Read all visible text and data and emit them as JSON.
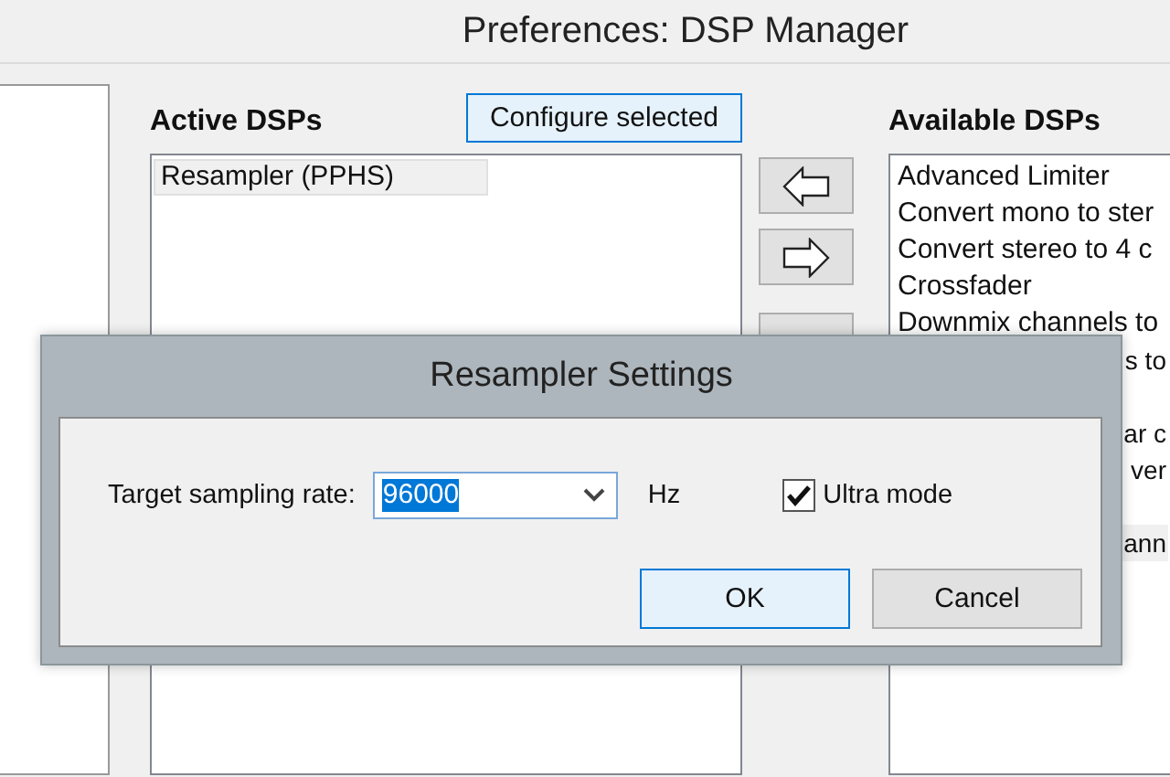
{
  "window": {
    "title": "Preferences: DSP Manager"
  },
  "active_dsps": {
    "label": "Active DSPs",
    "configure_button": "Configure selected",
    "items": [
      {
        "text": "Resampler (PPHS)",
        "selected": true
      }
    ]
  },
  "move_buttons": [
    {
      "kind": "left"
    },
    {
      "kind": "right"
    },
    {
      "kind": "blank"
    }
  ],
  "available_dsps": {
    "label": "Available DSPs",
    "items": [
      {
        "text": "Advanced Limiter",
        "kind": "full",
        "selected": false
      },
      {
        "text": "Convert mono to ster",
        "kind": "full",
        "selected": false
      },
      {
        "text": "Convert stereo to 4 c",
        "kind": "full",
        "selected": false
      },
      {
        "text": "Crossfader",
        "kind": "full",
        "selected": false
      },
      {
        "text": "Downmix channels to",
        "kind": "full",
        "selected": false
      },
      {
        "text": "s to",
        "kind": "clipped",
        "selected": false
      },
      {
        "kind": "hidden"
      },
      {
        "text": "ar c",
        "kind": "clipped",
        "selected": false
      },
      {
        "text": "ver",
        "kind": "clipped",
        "selected": false
      },
      {
        "kind": "hidden"
      },
      {
        "text": "ann",
        "kind": "clipped",
        "selected": true
      }
    ]
  },
  "dialog": {
    "title": "Resampler Settings",
    "rate_label": "Target sampling rate:",
    "rate_value": "96000",
    "unit": "Hz",
    "ultra_mode": {
      "label": "Ultra mode",
      "checked": true
    },
    "buttons": [
      {
        "label": "OK",
        "default": true
      },
      {
        "label": "Cancel",
        "default": false
      }
    ]
  }
}
